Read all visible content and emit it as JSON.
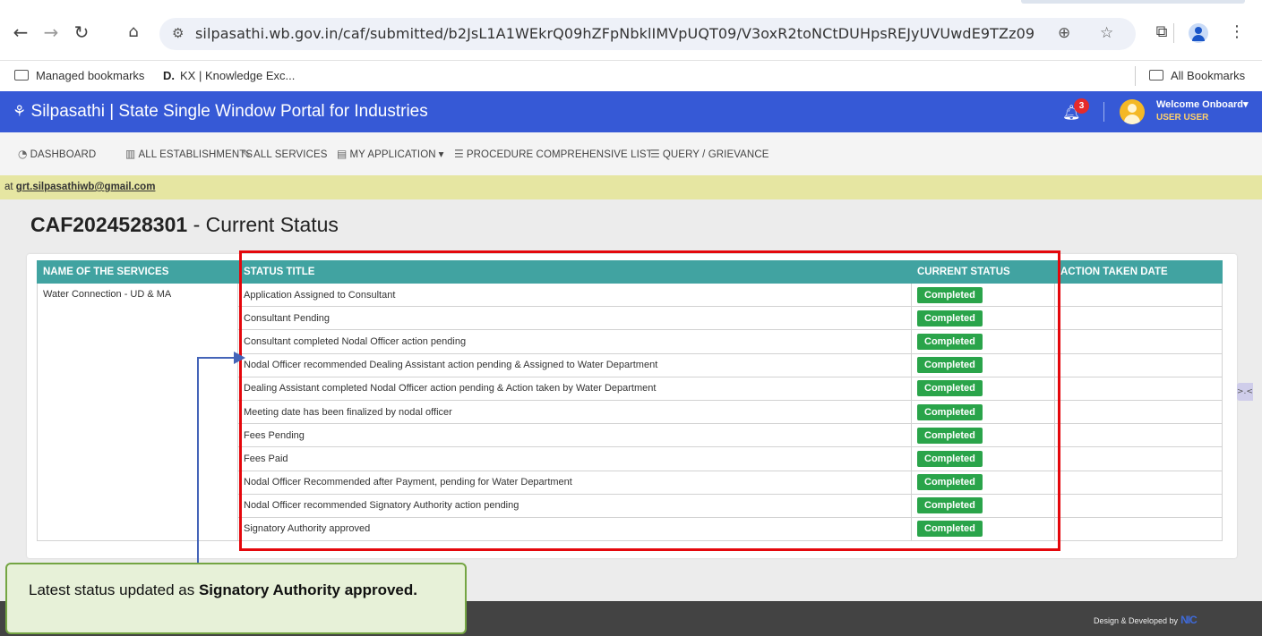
{
  "browser": {
    "url": "silpasathi.wb.gov.in/caf/submitted/b2JsL1A1WEkrQ09hZFpNbklIMVpUQT09/V3oxR2toNCtDUHpsREJyUVUwdE9TZz09",
    "icons": [
      "back-icon",
      "forward-icon",
      "reload-icon",
      "home-icon",
      "site-settings-icon",
      "zoom-icon",
      "star-icon",
      "extensions-icon",
      "profile-icon",
      "more-icon"
    ],
    "bookmarks": {
      "managed": "Managed bookmarks",
      "kx": "KX | Knowledge Exc...",
      "kx_icon": "D.",
      "all": "All Bookmarks"
    }
  },
  "header": {
    "title": "Silpasathi | State Single Window Portal for Industries",
    "notification_count": "3",
    "welcome": "Welcome Onboard",
    "user": "USER USER",
    "bg_color": "#3659d6"
  },
  "menu": {
    "items": [
      {
        "label": "DASHBOARD"
      },
      {
        "label": "ALL ESTABLISHMENTS"
      },
      {
        "label": "ALL SERVICES"
      },
      {
        "label": "MY APPLICATION"
      },
      {
        "label": "PROCEDURE COMPREHENSIVE LIST"
      },
      {
        "label": "QUERY / GRIEVANCE"
      }
    ]
  },
  "notice": {
    "prefix": "at",
    "email": "grt.silpasathiwb@gmail.com"
  },
  "page": {
    "caf_id": "CAF2024528301",
    "title_suffix": "- Current Status"
  },
  "table": {
    "headers": [
      "NAME OF THE SERVICES",
      "STATUS TITLE",
      "CURRENT STATUS",
      "ACTION TAKEN DATE"
    ],
    "service": "Water Connection - UD & MA",
    "rows": [
      {
        "title": "Application Assigned to Consultant",
        "status": "Completed",
        "date": ""
      },
      {
        "title": "Consultant Pending",
        "status": "Completed",
        "date": ""
      },
      {
        "title": "Consultant completed Nodal Officer action pending",
        "status": "Completed",
        "date": ""
      },
      {
        "title": "Nodal Officer recommended Dealing Assistant action pending & Assigned to Water Department",
        "status": "Completed",
        "date": ""
      },
      {
        "title": "Dealing Assistant completed Nodal Officer action pending & Action taken by Water Department",
        "status": "Completed",
        "date": ""
      },
      {
        "title": "Meeting date has been finalized by nodal officer",
        "status": "Completed",
        "date": ""
      },
      {
        "title": "Fees Pending",
        "status": "Completed",
        "date": ""
      },
      {
        "title": "Fees Paid",
        "status": "Completed",
        "date": ""
      },
      {
        "title": "Nodal Officer Recommended after Payment, pending for Water Department",
        "status": "Completed",
        "date": ""
      },
      {
        "title": "Nodal Officer recommended Signatory Authority action pending",
        "status": "Completed",
        "date": ""
      },
      {
        "title": "Signatory Authority approved",
        "status": "Completed",
        "date": ""
      }
    ],
    "header_color": "#41a3a1",
    "status_color": "#2aa44a"
  },
  "callout": {
    "text": "Latest status updated as ",
    "bold": "Signatory Authority approved."
  },
  "footer": {
    "text": "Design & Developed by",
    "logo": "NIC"
  }
}
